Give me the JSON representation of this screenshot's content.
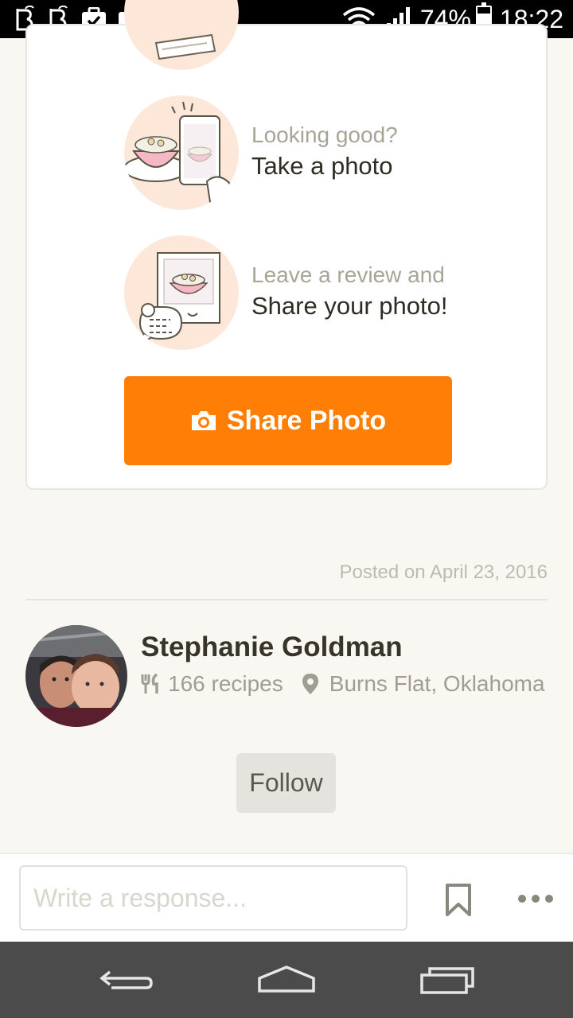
{
  "status_bar": {
    "left_icons": [
      "b-app-icon",
      "b-app-icon",
      "task-check-icon",
      "media-play-icon"
    ],
    "battery_percent": "74%",
    "battery_level": 0.74,
    "time": "18:22"
  },
  "steps": [
    {
      "illustration": "dish-photo-icon",
      "subtitle": "Looking good?",
      "title": "Take a photo"
    },
    {
      "illustration": "review-photo-icon",
      "subtitle": "Leave a review and",
      "title": "Share your photo!"
    }
  ],
  "share_button": {
    "label": "Share Photo",
    "icon": "camera-icon"
  },
  "posted_on": "Posted on April 23, 2016",
  "author": {
    "name": "Stephanie Goldman",
    "recipes": "166 recipes",
    "location": "Burns Flat, Oklahoma",
    "follow_label": "Follow"
  },
  "response": {
    "placeholder": "Write a response..."
  },
  "colors": {
    "accent": "#ff7f06",
    "background": "#f8f7f2",
    "navbar": "#4b4b4b"
  }
}
